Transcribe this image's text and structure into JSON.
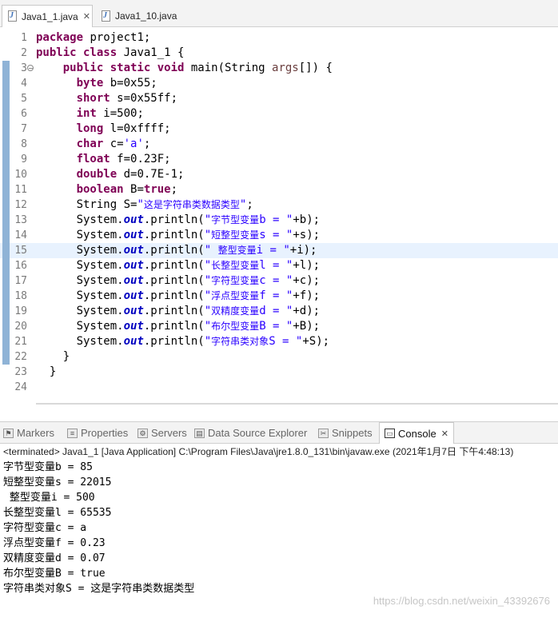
{
  "editor_tabs": [
    {
      "label": "Java1_1.java",
      "active": true,
      "close": "✕"
    },
    {
      "label": "Java1_10.java",
      "active": false
    }
  ],
  "code_lines": [
    {
      "n": "1",
      "html": "<span class=\"kw\">package</span> project1;"
    },
    {
      "n": "2",
      "html": "<span class=\"kw\">public class</span> Java1_1 {"
    },
    {
      "n": "3",
      "html": "    <span class=\"kw\">public static void</span> main(String <span style=\"color:#6a3e3e\">args</span>[]) {"
    },
    {
      "n": "4",
      "html": "      <span class=\"kw\">byte</span> b=0x55;"
    },
    {
      "n": "5",
      "html": "      <span class=\"kw\">short</span> s=0x55ff;"
    },
    {
      "n": "6",
      "html": "      <span class=\"kw\">int</span> i=500;"
    },
    {
      "n": "7",
      "html": "      <span class=\"kw\">long</span> l=0xffff;"
    },
    {
      "n": "8",
      "html": "      <span class=\"kw\">char</span> c=<span class=\"str\">'a'</span>;"
    },
    {
      "n": "9",
      "html": "      <span class=\"kw\">float</span> f=0.23F;"
    },
    {
      "n": "10",
      "html": "      <span class=\"kw\">double</span> d=0.7E-1;"
    },
    {
      "n": "11",
      "html": "      <span class=\"kw\">boolean</span> B=<span class=\"kw\">true</span>;"
    },
    {
      "n": "12",
      "html": "      String S=<span class=\"str\">\"<span class=\"cjk\">这是字符串类数据类型</span>\"</span>;"
    },
    {
      "n": "13",
      "html": "      System.<span class=\"field\">out</span>.println(<span class=\"str\">\"<span class=\"cjk\">字节型变量</span>b = \"</span>+b);"
    },
    {
      "n": "14",
      "html": "      System.<span class=\"field\">out</span>.println(<span class=\"str\">\"<span class=\"cjk\">短整型变量</span>s = \"</span>+s);"
    },
    {
      "n": "15",
      "html": "      System.<span class=\"field\">out</span>.println(<span class=\"str\">\" <span class=\"cjk\">整型变量</span>i = \"</span>+i);"
    },
    {
      "n": "16",
      "html": "      System.<span class=\"field\">out</span>.println(<span class=\"str\">\"<span class=\"cjk\">长整型变量</span>l = \"</span>+l);"
    },
    {
      "n": "17",
      "html": "      System.<span class=\"field\">out</span>.println(<span class=\"str\">\"<span class=\"cjk\">字符型变量</span>c = \"</span>+c);"
    },
    {
      "n": "18",
      "html": "      System.<span class=\"field\">out</span>.println(<span class=\"str\">\"<span class=\"cjk\">浮点型变量</span>f = \"</span>+f);"
    },
    {
      "n": "19",
      "html": "      System.<span class=\"field\">out</span>.println(<span class=\"str\">\"<span class=\"cjk\">双精度变量</span>d = \"</span>+d);"
    },
    {
      "n": "20",
      "html": "      System.<span class=\"field\">out</span>.println(<span class=\"str\">\"<span class=\"cjk\">布尔型变量</span>B = \"</span>+B);"
    },
    {
      "n": "21",
      "html": "      System.<span class=\"field\">out</span>.println(<span class=\"str\">\"<span class=\"cjk\">字符串类对象</span>S = \"</span>+S);"
    },
    {
      "n": "22",
      "html": "    }"
    },
    {
      "n": "23",
      "html": "  }"
    },
    {
      "n": "24",
      "html": ""
    }
  ],
  "highlighted_line": "15",
  "view_tabs": [
    {
      "label": "Markers",
      "icon": "markers-icon",
      "glyph": "⚑"
    },
    {
      "label": "Properties",
      "icon": "properties-icon",
      "glyph": "≡"
    },
    {
      "label": "Servers",
      "icon": "servers-icon",
      "glyph": "⚙"
    },
    {
      "label": "Data Source Explorer",
      "icon": "data-source-icon",
      "glyph": "▤"
    },
    {
      "label": "Snippets",
      "icon": "snippets-icon",
      "glyph": "✂"
    },
    {
      "label": "Console",
      "icon": "console-icon",
      "glyph": "▭",
      "active": true,
      "close": "✕"
    }
  ],
  "status_text": "<terminated> Java1_1 [Java Application] C:\\Program Files\\Java\\jre1.8.0_131\\bin\\javaw.exe (2021年1月7日 下午4:48:13)",
  "console_lines": [
    "字节型变量b = 85",
    "短整型变量s = 22015",
    " 整型变量i = 500",
    "长整型变量l = 65535",
    "字符型变量c = a",
    "浮点型变量f = 0.23",
    "双精度变量d = 0.07",
    "布尔型变量B = true",
    "字符串类对象S = 这是字符串类数据类型"
  ],
  "watermark": "https://blog.csdn.net/weixin_43392676"
}
